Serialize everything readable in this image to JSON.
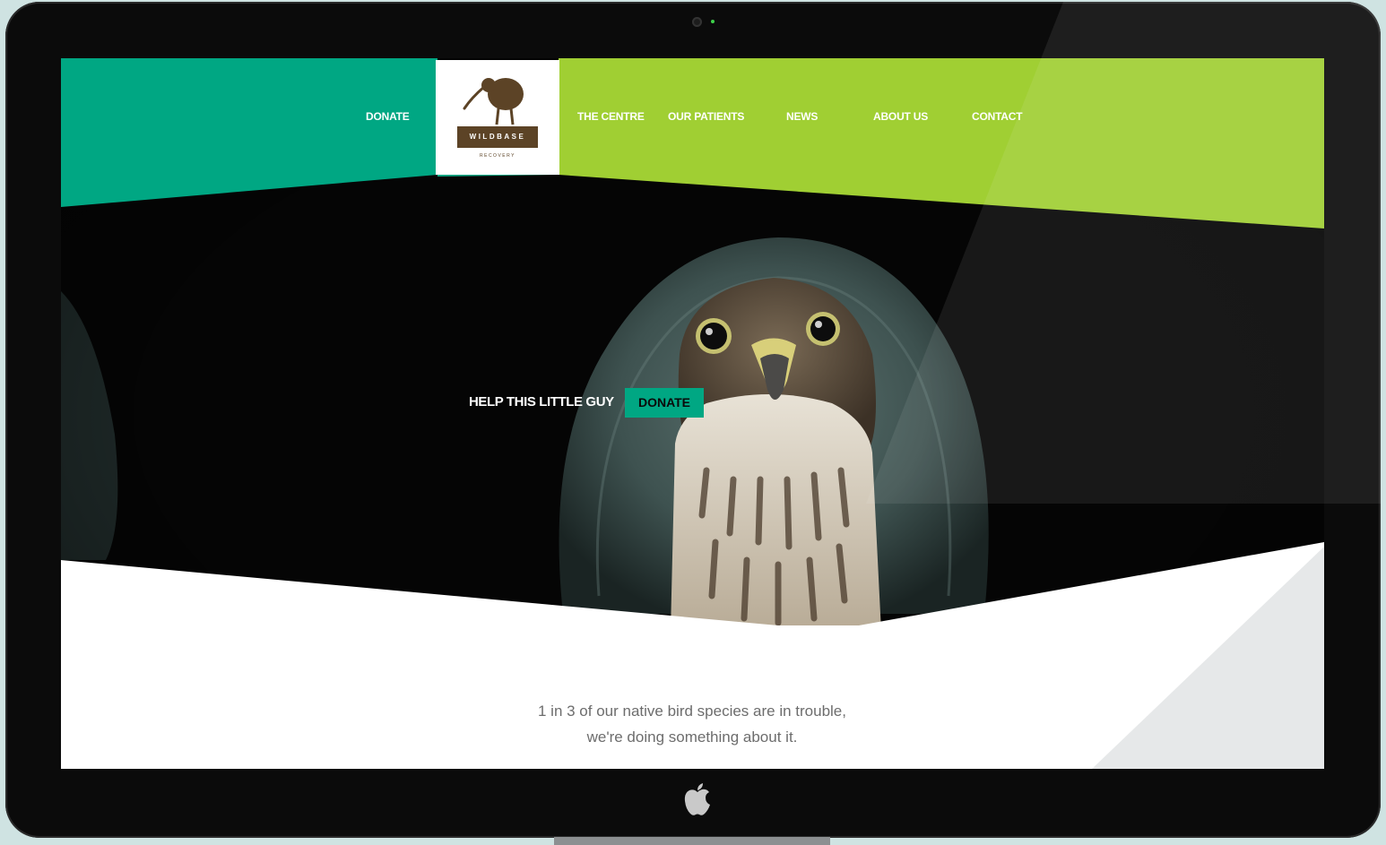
{
  "colors": {
    "teal": "#00a783",
    "lime": "#a0cf33",
    "logo_brown": "#5c4326",
    "text_gray": "#6d6d6d"
  },
  "nav": {
    "donate": "DONATE",
    "the_centre": "THE CENTRE",
    "our_patients": "OUR PATIENTS",
    "news": "NEWS",
    "about_us": "ABOUT US",
    "contact": "CONTACT"
  },
  "logo": {
    "name": "WILDBASE",
    "sub": "RECOVERY",
    "icon": "kiwi-bird-icon"
  },
  "hero": {
    "cta_text": "HELP THIS LITTLE GUY",
    "cta_button": "DONATE"
  },
  "tagline": {
    "line1": "1 in 3 of our native bird species are in trouble,",
    "line2": "we're doing something about it."
  },
  "device": {
    "logo_icon": "apple-icon"
  }
}
